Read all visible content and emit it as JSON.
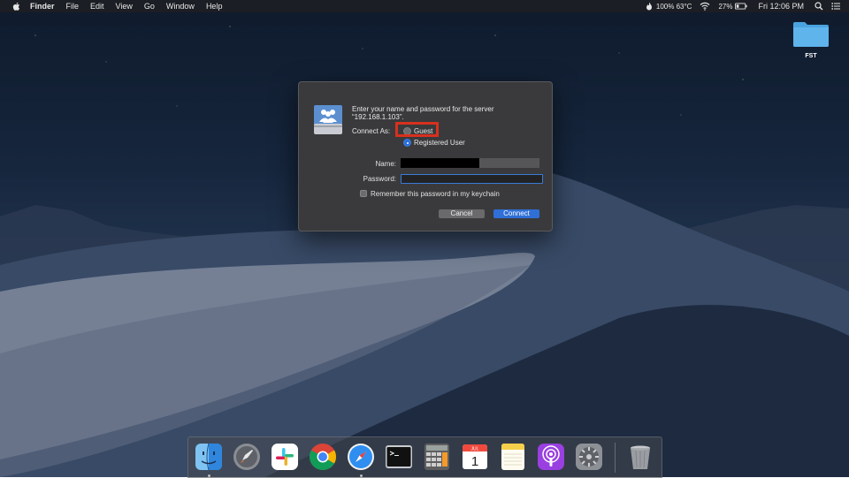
{
  "menubar": {
    "app_name": "Finder",
    "menus": [
      "File",
      "Edit",
      "View",
      "Go",
      "Window",
      "Help"
    ],
    "status": {
      "battery_temp": "100% 63°C",
      "battery_percent": "27%",
      "clock": "Fri 12:06 PM"
    }
  },
  "desktop": {
    "folder_label": "FST"
  },
  "dialog": {
    "message_line1": "Enter your name and password for the server",
    "message_line2": "“192.168.1.103”.",
    "connect_as_label": "Connect As:",
    "options": {
      "guest": "Guest",
      "registered": "Registered User"
    },
    "selected_option": "registered",
    "name_label": "Name:",
    "name_value": "",
    "password_label": "Password:",
    "password_value": "",
    "remember_label": "Remember this password in my keychain",
    "remember_checked": false,
    "cancel_label": "Cancel",
    "connect_label": "Connect",
    "accent_color": "#2f6fd6",
    "highlight_color": "#d8301e"
  },
  "dock": {
    "apps": [
      "finder-icon",
      "launchpad-icon",
      "slack-icon",
      "chrome-icon",
      "safari-icon",
      "terminal-icon",
      "calculator-icon",
      "calendar-icon",
      "notes-icon",
      "podcasts-icon",
      "system-preferences-icon",
      "trash-icon"
    ],
    "calendar_month": "JUL",
    "calendar_day": "1"
  }
}
